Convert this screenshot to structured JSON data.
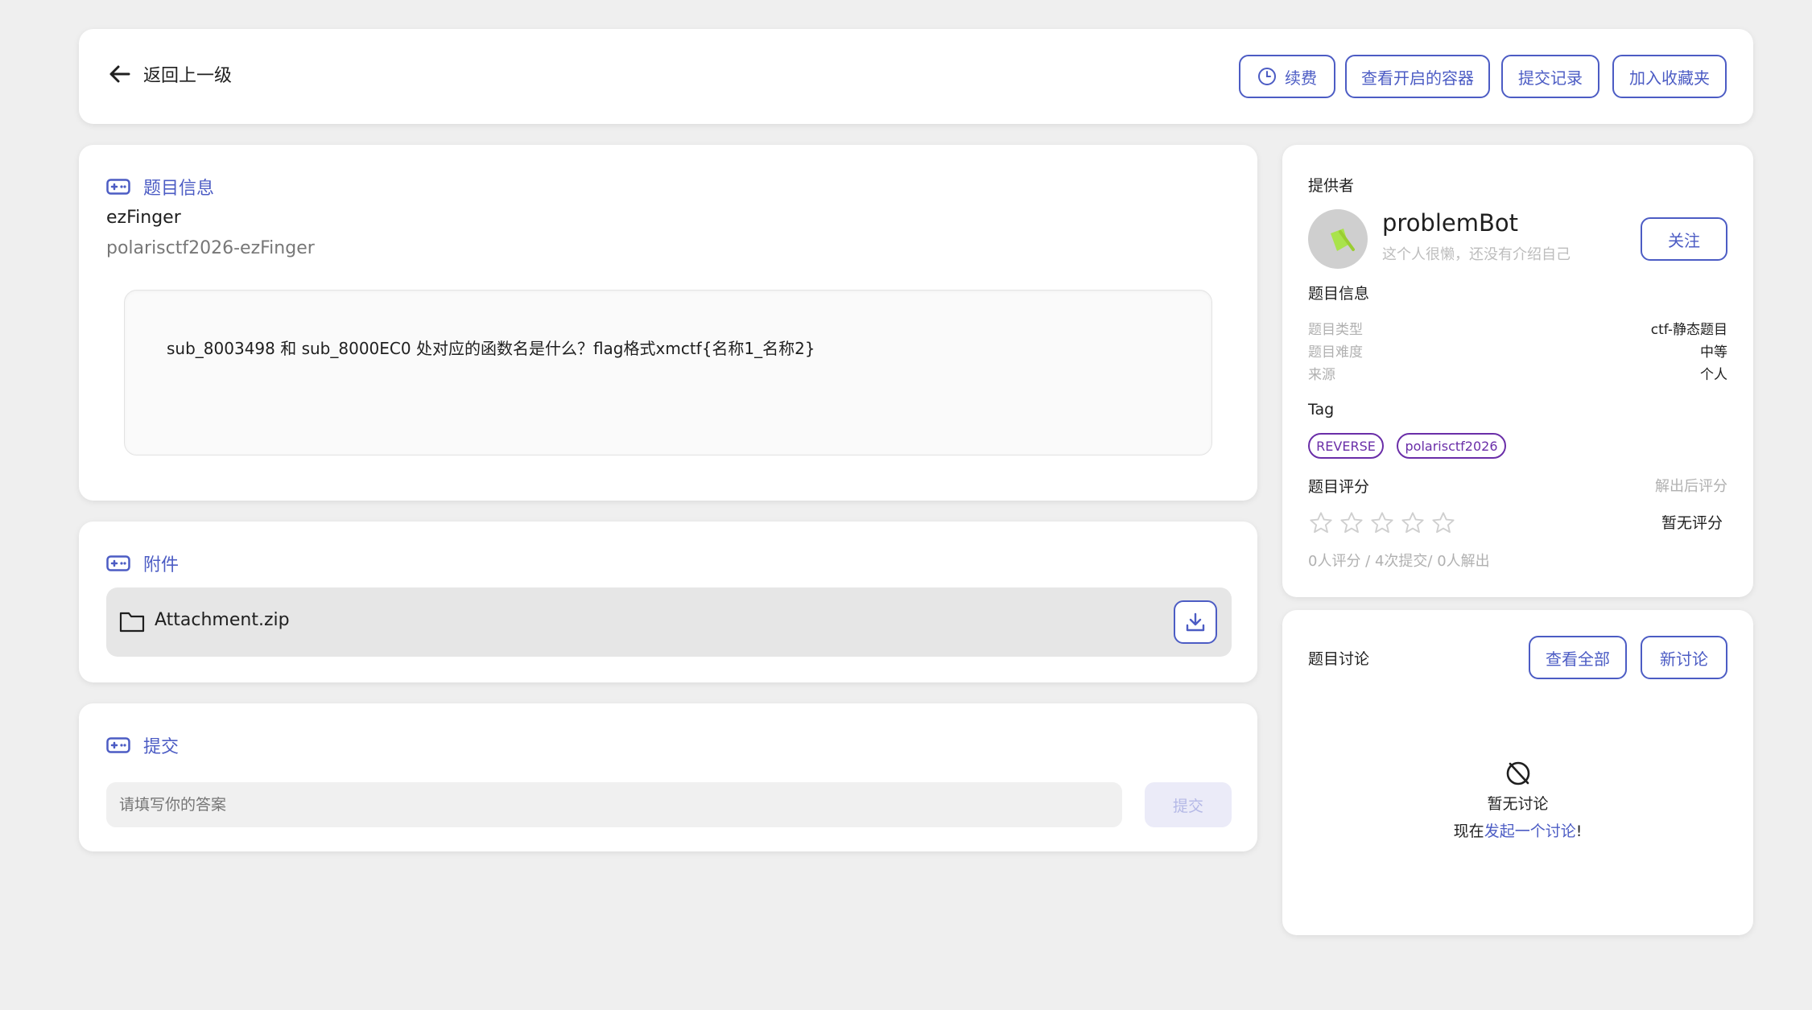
{
  "header": {
    "back_label": "返回上一级",
    "renew_label": "续费",
    "containers_label": "查看开启的容器",
    "submissions_label": "提交记录",
    "favorite_label": "加入收藏夹"
  },
  "challenge": {
    "section_title": "题目信息",
    "name": "ezFinger",
    "full_id": "polarisctf2026-ezFinger",
    "description": "sub_8003498 和 sub_8000EC0 处对应的函数名是什么？flag格式xmctf{名称1_名称2}"
  },
  "attachment": {
    "section_title": "附件",
    "file_name": "Attachment.zip"
  },
  "submit": {
    "section_title": "提交",
    "placeholder": "请填写你的答案",
    "button_label": "提交"
  },
  "provider": {
    "heading": "提供者",
    "name": "problemBot",
    "bio": "这个人很懒，还没有介绍自己",
    "follow_label": "关注"
  },
  "info": {
    "heading": "题目信息",
    "rows": [
      {
        "label": "题目类型",
        "value": "ctf-静态题目"
      },
      {
        "label": "题目难度",
        "value": "中等"
      },
      {
        "label": "来源",
        "value": "个人"
      }
    ]
  },
  "tags": {
    "heading": "Tag",
    "items": [
      "REVERSE",
      "polarisctf2026"
    ]
  },
  "rating": {
    "heading": "题目评分",
    "hint": "解出后评分",
    "stars_filled": 0,
    "stars_total": 5,
    "none_label": "暂无评分",
    "stats": "0人评分 / 4次提交/ 0人解出"
  },
  "discussion": {
    "heading": "题目讨论",
    "view_all_label": "查看全部",
    "new_label": "新讨论",
    "empty_title": "暂无讨论",
    "prompt_prefix": "现在",
    "prompt_link": "发起一个讨论",
    "prompt_suffix": "!"
  },
  "colors": {
    "accent": "#4c5cc4",
    "tag": "#6a2ea8",
    "background": "#efefef"
  }
}
